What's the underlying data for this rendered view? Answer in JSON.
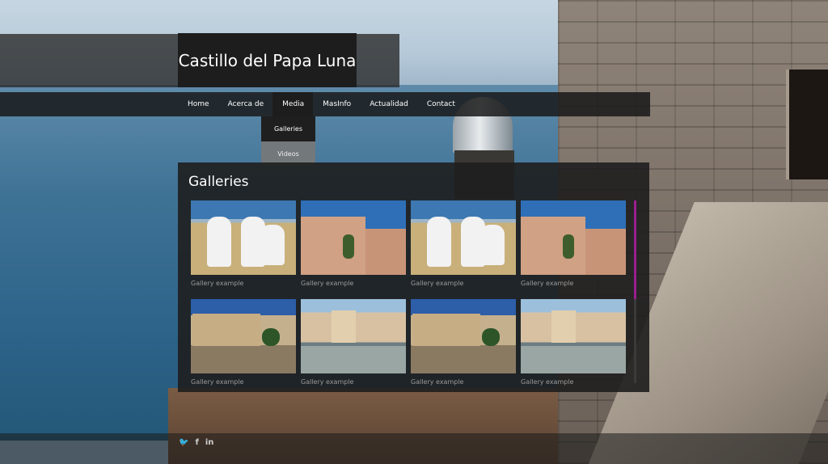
{
  "header": {
    "title": "Castillo del Papa Luna"
  },
  "nav": {
    "items": [
      "Home",
      "Acerca de",
      "Media",
      "MasInfo",
      "Actualidad",
      "Contact"
    ],
    "active": "Media",
    "dropdown": [
      "Galleries",
      "Videos"
    ]
  },
  "content": {
    "title": "Galleries",
    "galleries": [
      {
        "caption": "Gallery example",
        "image": "white-dog-sculptures"
      },
      {
        "caption": "Gallery example",
        "image": "castle-wall-tower"
      },
      {
        "caption": "Gallery example",
        "image": "white-dog-sculptures"
      },
      {
        "caption": "Gallery example",
        "image": "castle-wall-tower"
      },
      {
        "caption": "Gallery example",
        "image": "castle-entrance-palms"
      },
      {
        "caption": "Gallery example",
        "image": "fortress-on-rocks"
      },
      {
        "caption": "Gallery example",
        "image": "castle-entrance-palms"
      },
      {
        "caption": "Gallery example",
        "image": "fortress-on-rocks"
      }
    ],
    "scrollbar_color": "#9a1e8f"
  },
  "footer": {
    "social": [
      {
        "icon": "twitter-icon",
        "glyph": "🐦"
      },
      {
        "icon": "facebook-icon",
        "glyph": "f"
      },
      {
        "icon": "linkedin-icon",
        "glyph": "in"
      }
    ]
  }
}
